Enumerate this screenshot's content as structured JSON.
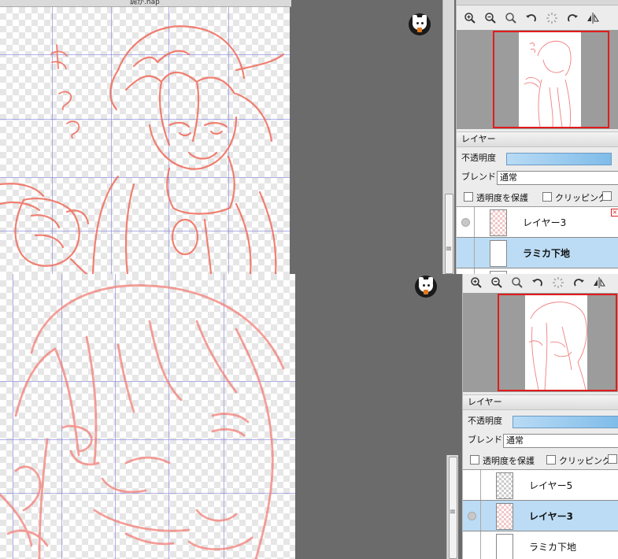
{
  "top": {
    "tab_text": "調が.hap",
    "handwritten_note": "まつる",
    "layers_title": "レイヤー",
    "opacity_label": "不透明度",
    "blend_label": "ブレンド",
    "blend_value": "通常",
    "protect_label": "透明度を保護",
    "clipping_label": "クリッピング",
    "layers": [
      {
        "name": "レイヤー3",
        "selected": false,
        "bold": false
      },
      {
        "name": "ラミカ下地",
        "selected": true,
        "bold": true
      }
    ]
  },
  "bottom": {
    "layers_title": "レイヤー",
    "opacity_label": "不透明度",
    "blend_label": "ブレンド",
    "blend_value": "通常",
    "protect_label": "透明度を保護",
    "clipping_label": "クリッピング",
    "layers": [
      {
        "name": "レイヤー5",
        "selected": false,
        "bold": false
      },
      {
        "name": "レイヤー3",
        "selected": true,
        "bold": true
      },
      {
        "name": "ラミカ下地",
        "selected": false,
        "bold": false
      }
    ]
  },
  "icons": [
    "zoom-in-icon",
    "zoom-out-icon",
    "zoom-reset-icon",
    "rotate-left-icon",
    "rotate-reset-icon",
    "rotate-right-icon",
    "flip-horizontal-icon"
  ],
  "colors": {
    "sketch": "#f06a5a",
    "guide": "#8f8fe0",
    "nav_border": "#e01c1c",
    "selected_layer": "#bcdcf5"
  }
}
